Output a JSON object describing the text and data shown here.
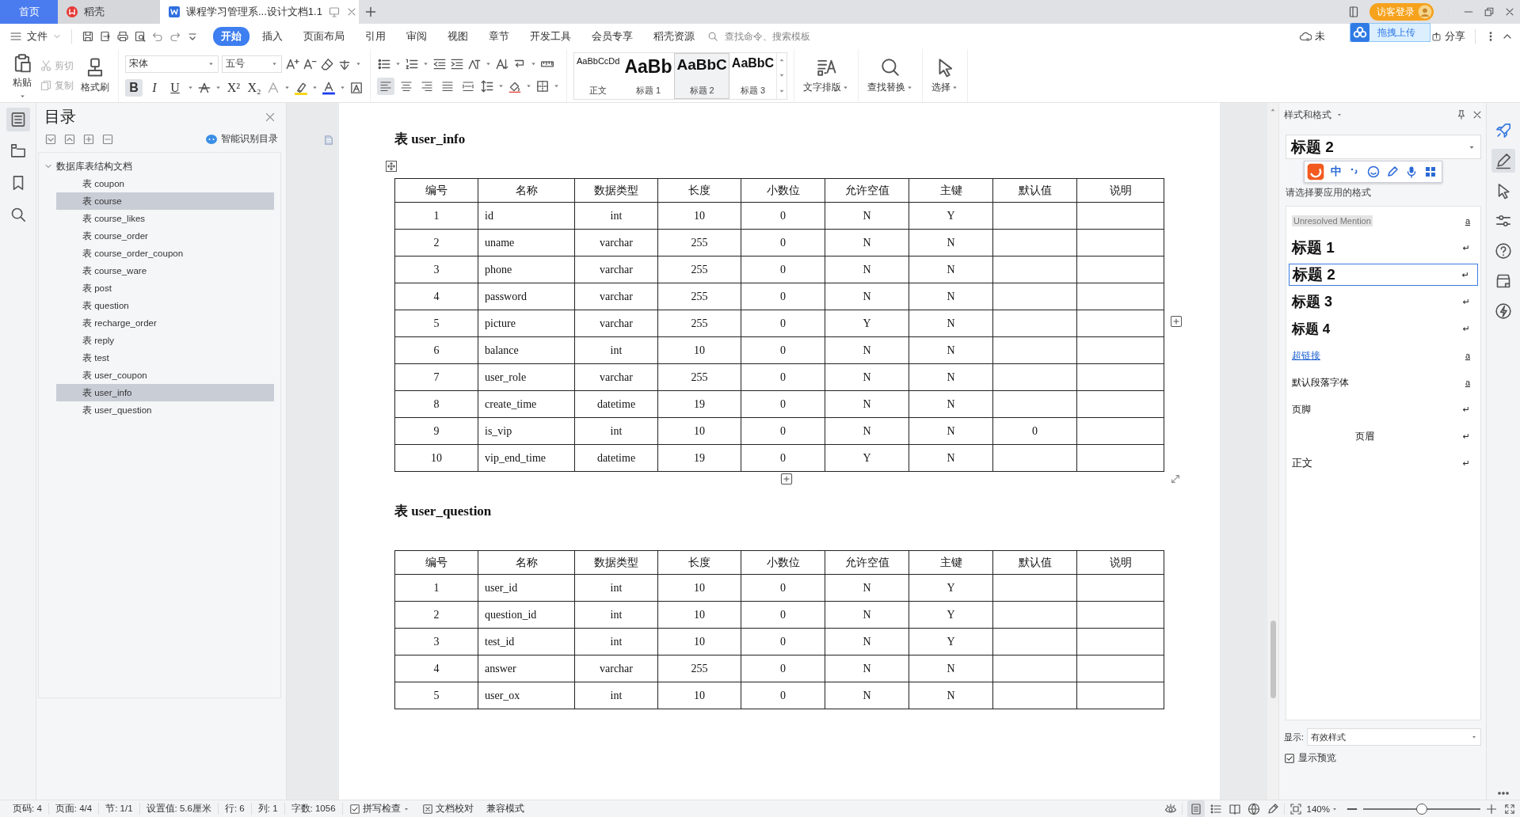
{
  "tabs": [
    {
      "label": "首页",
      "kind": "home",
      "selected": false
    },
    {
      "label": "稻壳",
      "kind": "docer",
      "selected": false
    },
    {
      "label": "课程学习管理系...设计文档1.1",
      "kind": "doc",
      "selected": true
    }
  ],
  "guest_login": "访客登录",
  "upload_popup": "拖拽上传",
  "menu": {
    "file": "文件",
    "items": [
      {
        "label": "开始",
        "selected": true
      },
      {
        "label": "插入",
        "selected": false
      },
      {
        "label": "页面布局",
        "selected": false
      },
      {
        "label": "引用",
        "selected": false
      },
      {
        "label": "审阅",
        "selected": false
      },
      {
        "label": "视图",
        "selected": false
      },
      {
        "label": "章节",
        "selected": false
      },
      {
        "label": "开发工具",
        "selected": false
      },
      {
        "label": "会员专享",
        "selected": false
      },
      {
        "label": "稻壳资源",
        "selected": false
      }
    ],
    "search": {
      "placeholder": "查找命令、搜索模板"
    },
    "sync": "未",
    "share": "分享"
  },
  "ribbon": {
    "paste": "粘贴",
    "cut": {
      "label": "剪切",
      "disabled": true
    },
    "copy": {
      "label": "复制",
      "disabled": true
    },
    "format_painter": "格式刷",
    "font": {
      "name": "宋体",
      "size": "五号"
    },
    "format_buttons": [
      {
        "kind": "bold",
        "label": "B",
        "selected": true
      },
      {
        "kind": "italic",
        "label": "I",
        "selected": false
      },
      {
        "kind": "underline",
        "label": "U",
        "selected": false
      },
      {
        "kind": "sup",
        "label": "X²",
        "selected": false
      },
      {
        "kind": "sub",
        "label": "X₂",
        "selected": false
      }
    ],
    "paragraph_align": [
      {
        "kind": "left",
        "selected": true
      },
      {
        "kind": "center",
        "selected": false
      },
      {
        "kind": "right",
        "selected": false
      },
      {
        "kind": "justify",
        "selected": false
      },
      {
        "kind": "distributed",
        "selected": false
      }
    ],
    "styles": [
      {
        "preview": "AaBbCcDd",
        "label": "正文",
        "kind": "body",
        "selected": false
      },
      {
        "preview": "AaBb",
        "label": "标题 1",
        "kind": "h1",
        "selected": false
      },
      {
        "preview": "AaBbC",
        "label": "标题 2",
        "kind": "h2",
        "selected": true
      },
      {
        "preview": "AaBbC",
        "label": "标题 3",
        "kind": "h3",
        "selected": false
      }
    ],
    "tools": [
      {
        "kind": "layout",
        "label": "文字排版"
      },
      {
        "kind": "find",
        "label": "查找替换"
      },
      {
        "kind": "select",
        "label": "选择"
      }
    ]
  },
  "nav": [
    {
      "kind": "toc",
      "selected": true
    },
    {
      "kind": "navigation",
      "selected": false
    },
    {
      "kind": "bookmark",
      "selected": false
    },
    {
      "kind": "search",
      "selected": false
    }
  ],
  "toc": {
    "title": "目录",
    "smart": "智能识别目录",
    "root": {
      "label": "数据库表结构文档",
      "expanded": true,
      "children": [
        {
          "label": "表 coupon",
          "selected": false
        },
        {
          "label": "表 course",
          "selected": true
        },
        {
          "label": "表 course_likes",
          "selected": false
        },
        {
          "label": "表 course_order",
          "selected": false
        },
        {
          "label": "表 course_order_coupon",
          "selected": false
        },
        {
          "label": "表 course_ware",
          "selected": false
        },
        {
          "label": "表 post",
          "selected": false
        },
        {
          "label": "表 question",
          "selected": false
        },
        {
          "label": "表 recharge_order",
          "selected": false
        },
        {
          "label": "表 reply",
          "selected": false
        },
        {
          "label": "表 test",
          "selected": false
        },
        {
          "label": "表 user_coupon",
          "selected": false
        },
        {
          "label": "表 user_info",
          "selected": true
        },
        {
          "label": "表 user_question",
          "selected": false
        }
      ]
    }
  },
  "document": {
    "tables": [
      {
        "title": "表 user_info",
        "columns": [
          "编号",
          "名称",
          "数据类型",
          "长度",
          "小数位",
          "允许空值",
          "主键",
          "默认值",
          "说明"
        ],
        "rows": [
          [
            "1",
            "id",
            "int",
            "10",
            "0",
            "N",
            "Y"
          ],
          [
            "2",
            "uname",
            "varchar",
            "255",
            "0",
            "N",
            "N"
          ],
          [
            "3",
            "phone",
            "varchar",
            "255",
            "0",
            "N",
            "N"
          ],
          [
            "4",
            "password",
            "varchar",
            "255",
            "0",
            "N",
            "N"
          ],
          [
            "5",
            "picture",
            "varchar",
            "255",
            "0",
            "Y",
            "N"
          ],
          [
            "6",
            "balance",
            "int",
            "10",
            "0",
            "N",
            "N"
          ],
          [
            "7",
            "user_role",
            "varchar",
            "255",
            "0",
            "N",
            "N"
          ],
          [
            "8",
            "create_time",
            "datetime",
            "19",
            "0",
            "N",
            "N"
          ],
          [
            "9",
            "is_vip",
            "int",
            "10",
            "0",
            "N",
            "N",
            "0"
          ],
          [
            "10",
            "vip_end_time",
            "datetime",
            "19",
            "0",
            "Y",
            "N"
          ]
        ]
      },
      {
        "title": "表 user_question",
        "columns": [
          "编号",
          "名称",
          "数据类型",
          "长度",
          "小数位",
          "允许空值",
          "主键",
          "默认值",
          "说明"
        ],
        "rows": [
          [
            "1",
            "user_id",
            "int",
            "10",
            "0",
            "N",
            "Y"
          ],
          [
            "2",
            "question_id",
            "int",
            "10",
            "0",
            "N",
            "Y"
          ],
          [
            "3",
            "test_id",
            "int",
            "10",
            "0",
            "N",
            "Y"
          ],
          [
            "4",
            "answer",
            "varchar",
            "255",
            "0",
            "N",
            "N"
          ],
          [
            "5",
            "user_ox",
            "int",
            "10",
            "0",
            "N",
            "N"
          ]
        ]
      }
    ]
  },
  "style_panel": {
    "title": "样式和格式",
    "current": "标题 2",
    "ime": "中",
    "hint": "请选择要应用的格式",
    "styles": [
      {
        "kind": "mention",
        "label": "Unresolved Mention",
        "mark": "a",
        "selected": false
      },
      {
        "kind": "h1",
        "label": "标题 1",
        "mark": "↵",
        "selected": false
      },
      {
        "kind": "h2",
        "label": "标题 2",
        "mark": "↵",
        "selected": true
      },
      {
        "kind": "h3",
        "label": "标题 3",
        "mark": "↵",
        "selected": false
      },
      {
        "kind": "h4",
        "label": "标题 4",
        "mark": "↵",
        "selected": false
      },
      {
        "kind": "link",
        "label": "超链接",
        "mark": "a",
        "selected": false
      },
      {
        "kind": "plain",
        "label": "默认段落字体",
        "mark": "a",
        "selected": false
      },
      {
        "kind": "footer",
        "label": "页脚",
        "mark": "↵",
        "selected": false
      },
      {
        "kind": "header",
        "label": "页眉",
        "mark": "↵",
        "selected": false
      },
      {
        "kind": "body",
        "label": "正文",
        "mark": "↵",
        "selected": false
      }
    ],
    "show_label": "显示:",
    "show_value": "有效样式",
    "preview": {
      "label": "显示预览",
      "checked": true
    }
  },
  "tools": [
    {
      "kind": "rocket",
      "selected": false
    },
    {
      "kind": "style",
      "selected": true
    },
    {
      "kind": "select",
      "selected": false
    },
    {
      "kind": "adjust",
      "selected": false
    },
    {
      "kind": "help",
      "selected": false
    },
    {
      "kind": "shop",
      "selected": false
    },
    {
      "kind": "bolt",
      "selected": false
    }
  ],
  "status": {
    "items": [
      "页码: 4",
      "页面: 4/4",
      "节: 1/1",
      "设置值: 5.6厘米",
      "行: 6",
      "列: 1",
      "字数: 1056"
    ],
    "spell": "拼写检查",
    "proof": "文档校对",
    "compat": "兼容模式",
    "zoom": "140%",
    "zoom_slider": {
      "level": 0.5
    }
  }
}
